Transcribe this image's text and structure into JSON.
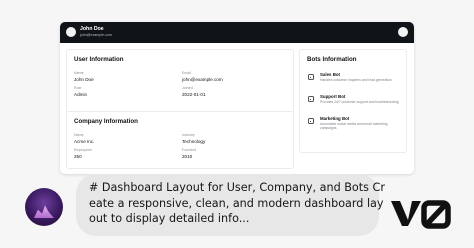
{
  "header": {
    "user_name": "John Doe",
    "user_email": "john@example.com"
  },
  "user_info": {
    "title": "User Information",
    "fields": [
      {
        "label": "Name",
        "value": "John Doe"
      },
      {
        "label": "Email",
        "value": "john@example.com"
      },
      {
        "label": "Role",
        "value": "Admin"
      },
      {
        "label": "Joined",
        "value": "2022-01-01"
      }
    ]
  },
  "company_info": {
    "title": "Company Information",
    "fields": [
      {
        "label": "Name",
        "value": "Acme Inc."
      },
      {
        "label": "Industry",
        "value": "Technology"
      },
      {
        "label": "Employees",
        "value": "250"
      },
      {
        "label": "Founded",
        "value": "2010"
      }
    ]
  },
  "bots_info": {
    "title": "Bots Information",
    "bots": [
      {
        "name": "Sales Bot",
        "description": "Handles customer inquiries and lead generation",
        "icon": "bot-icon"
      },
      {
        "name": "Support Bot",
        "description": "Provides 24/7 customer support and troubleshooting",
        "icon": "bot-icon"
      },
      {
        "name": "Marketing Bot",
        "description": "Automates social media and email marketing campaigns",
        "icon": "bot-icon"
      }
    ]
  },
  "chat": {
    "lines": [
      "# Dashboard Layout for User, Company, and Bots Cr",
      "eate a responsive, clean, and modern dashboard lay",
      "out to display detailed info..."
    ]
  },
  "brand": {
    "logo": "V0 logo"
  }
}
